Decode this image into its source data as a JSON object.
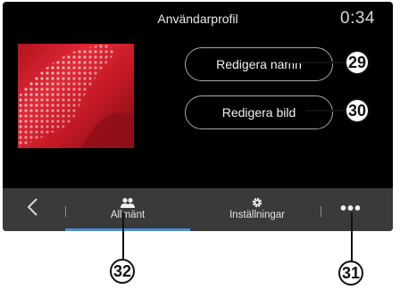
{
  "header": {
    "title": "Användarprofil",
    "clock": "0:34"
  },
  "profile": {
    "image_icon": "profile-photo",
    "edit_name_label": "Redigera namn",
    "edit_picture_label": "Redigera bild"
  },
  "bottom_bar": {
    "back_icon": "chevron-left-icon",
    "tabs": [
      {
        "label": "Allmänt",
        "icon": "users-icon",
        "active": true
      },
      {
        "label": "Inställningar",
        "icon": "gear-icon",
        "active": false
      }
    ],
    "more_icon": "more-dots-icon",
    "more_glyph": "•••",
    "accent_color": "#4a8fd0"
  },
  "callouts": {
    "edit_name": "29",
    "edit_picture": "30",
    "more": "31",
    "general_tab": "32"
  }
}
